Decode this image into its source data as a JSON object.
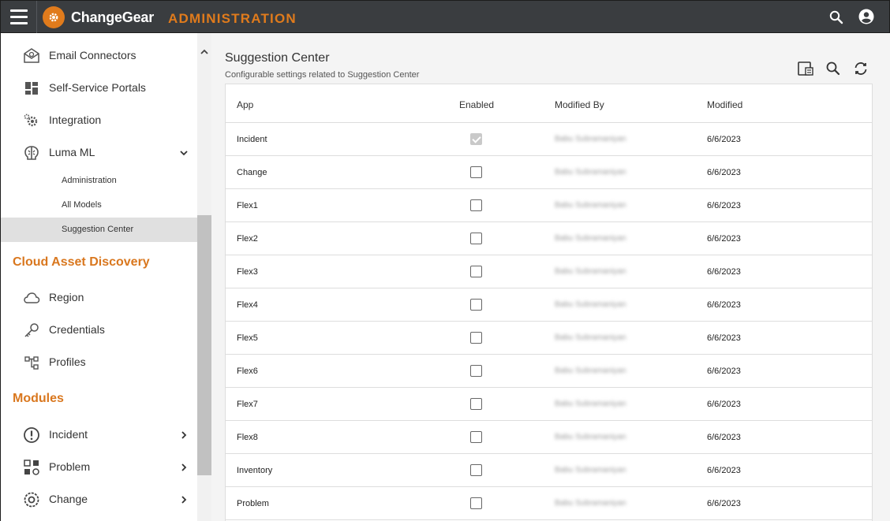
{
  "header": {
    "brand": "ChangeGear",
    "section": "ADMINISTRATION",
    "icons": [
      "menu-icon",
      "gear-logo-icon",
      "search-icon",
      "user-account-icon"
    ],
    "accent_color": "#e07b1c"
  },
  "sidebar": {
    "items": [
      {
        "label": "Email Connectors",
        "icon": "email-connector-icon"
      },
      {
        "label": "Self-Service Portals",
        "icon": "grid-tiles-icon"
      },
      {
        "label": "Integration",
        "icon": "integration-gears-icon"
      },
      {
        "label": "Luma ML",
        "icon": "brain-icon",
        "expanded": true
      }
    ],
    "sub_items": [
      {
        "label": "Administration"
      },
      {
        "label": "All Models"
      },
      {
        "label": "Suggestion Center",
        "active": true
      }
    ],
    "group_cloud": "Cloud Asset Discovery",
    "cloud_items": [
      {
        "label": "Region",
        "icon": "cloud-icon"
      },
      {
        "label": "Credentials",
        "icon": "key-icon"
      },
      {
        "label": "Profiles",
        "icon": "hierarchy-icon"
      }
    ],
    "group_modules": "Modules",
    "module_items": [
      {
        "label": "Incident",
        "icon": "alert-circle-icon"
      },
      {
        "label": "Problem",
        "icon": "shapes-icon"
      },
      {
        "label": "Change",
        "icon": "change-cycle-icon"
      }
    ]
  },
  "page": {
    "title": "Suggestion Center",
    "subtitle": "Configurable settings related to Suggestion Center",
    "toolbar_icons": [
      "column-chooser-icon",
      "search-icon",
      "refresh-icon"
    ]
  },
  "table": {
    "columns": [
      "App",
      "Enabled",
      "Modified By",
      "Modified"
    ],
    "rows": [
      {
        "app": "Incident",
        "enabled": true,
        "modified_by": "Babu Subramaniyan",
        "modified": "6/6/2023"
      },
      {
        "app": "Change",
        "enabled": false,
        "modified_by": "Babu Subramaniyan",
        "modified": "6/6/2023"
      },
      {
        "app": "Flex1",
        "enabled": false,
        "modified_by": "Babu Subramaniyan",
        "modified": "6/6/2023"
      },
      {
        "app": "Flex2",
        "enabled": false,
        "modified_by": "Babu Subramaniyan",
        "modified": "6/6/2023"
      },
      {
        "app": "Flex3",
        "enabled": false,
        "modified_by": "Babu Subramaniyan",
        "modified": "6/6/2023"
      },
      {
        "app": "Flex4",
        "enabled": false,
        "modified_by": "Babu Subramaniyan",
        "modified": "6/6/2023"
      },
      {
        "app": "Flex5",
        "enabled": false,
        "modified_by": "Babu Subramaniyan",
        "modified": "6/6/2023"
      },
      {
        "app": "Flex6",
        "enabled": false,
        "modified_by": "Babu Subramaniyan",
        "modified": "6/6/2023"
      },
      {
        "app": "Flex7",
        "enabled": false,
        "modified_by": "Babu Subramaniyan",
        "modified": "6/6/2023"
      },
      {
        "app": "Flex8",
        "enabled": false,
        "modified_by": "Babu Subramaniyan",
        "modified": "6/6/2023"
      },
      {
        "app": "Inventory",
        "enabled": false,
        "modified_by": "Babu Subramaniyan",
        "modified": "6/6/2023"
      },
      {
        "app": "Problem",
        "enabled": false,
        "modified_by": "Babu Subramaniyan",
        "modified": "6/6/2023"
      }
    ]
  }
}
